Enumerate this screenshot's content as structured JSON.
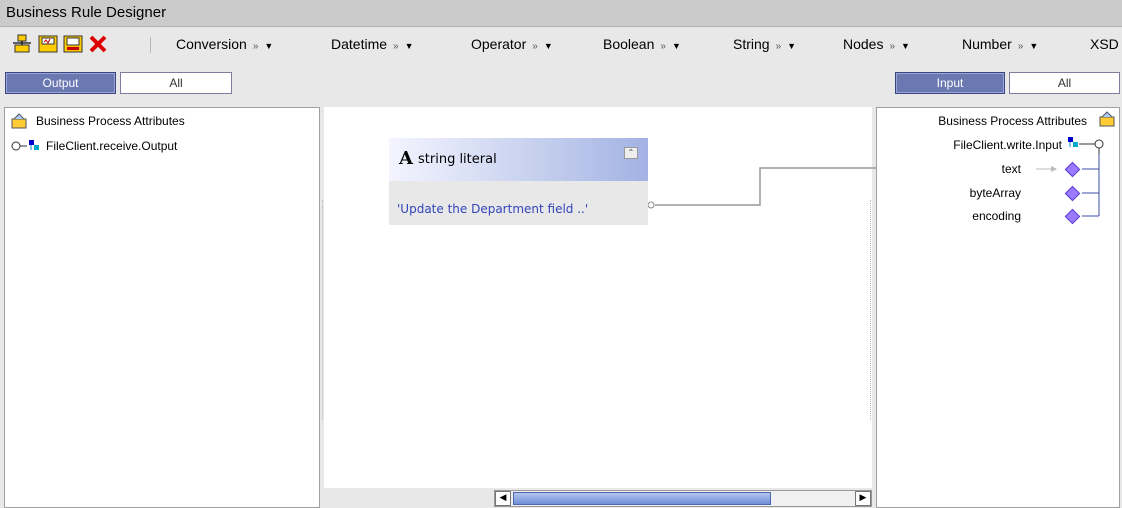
{
  "window": {
    "title": "Business Rule Designer"
  },
  "toolbar": {
    "icons": [
      "add-rule-icon",
      "edit-rule-icon",
      "save-rule-icon",
      "delete-icon"
    ],
    "menus": [
      {
        "label": "Conversion"
      },
      {
        "label": "Datetime"
      },
      {
        "label": "Operator"
      },
      {
        "label": "Boolean"
      },
      {
        "label": "String"
      },
      {
        "label": "Nodes"
      },
      {
        "label": "Number"
      },
      {
        "label": "XSD"
      }
    ],
    "menu_glyph_expand": "»",
    "menu_glyph_arrow": "▼"
  },
  "left_tabs": {
    "output": "Output",
    "all": "All"
  },
  "right_tabs": {
    "input": "Input",
    "all": "All"
  },
  "left_panel": {
    "root": "Business Process Attributes",
    "item": "FileClient.receive.Output"
  },
  "right_panel": {
    "root": "Business Process Attributes",
    "item": "FileClient.write.Input",
    "fields": [
      "text",
      "byteArray",
      "encoding"
    ]
  },
  "node": {
    "letter": "A",
    "title": "string literal",
    "value": "'Update the Department field ..'",
    "collapse_glyph": "⌃"
  },
  "scrollbar": {
    "left_arrow": "◀",
    "right_arrow": "▶"
  },
  "colors": {
    "accent": "#6b79b3",
    "node_value": "#3344bb",
    "diamond": "#9a7bff"
  }
}
